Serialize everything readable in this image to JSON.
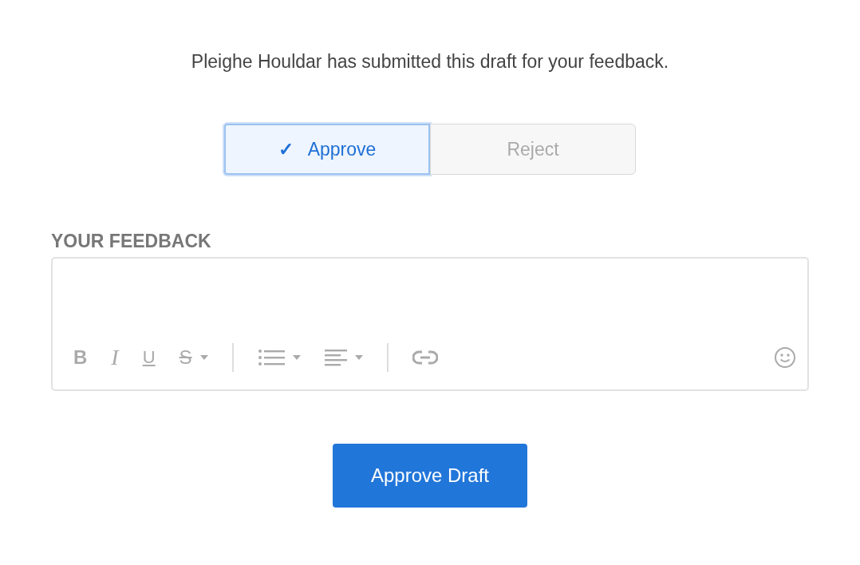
{
  "message": "Pleighe Houldar has submitted this draft for your feedback.",
  "decision": [
    {
      "label": "Approve",
      "check": "✓",
      "selected": true
    },
    {
      "label": "Reject",
      "selected": false
    }
  ],
  "feedback": {
    "label": "YOUR FEEDBACK",
    "toolbar": [
      {
        "kind": "bold",
        "glyph": "B",
        "dropdown": false
      },
      {
        "kind": "italic",
        "glyph": "I",
        "dropdown": false
      },
      {
        "kind": "underline",
        "glyph": "U",
        "dropdown": false
      },
      {
        "kind": "strike",
        "glyph": "S",
        "dropdown": true
      },
      {
        "kind": "divider"
      },
      {
        "kind": "list",
        "dropdown": true
      },
      {
        "kind": "align",
        "dropdown": true
      },
      {
        "kind": "divider"
      },
      {
        "kind": "link",
        "dropdown": false
      },
      {
        "kind": "emoji",
        "dropdown": false
      }
    ]
  },
  "submit": {
    "label": "Approve Draft"
  }
}
